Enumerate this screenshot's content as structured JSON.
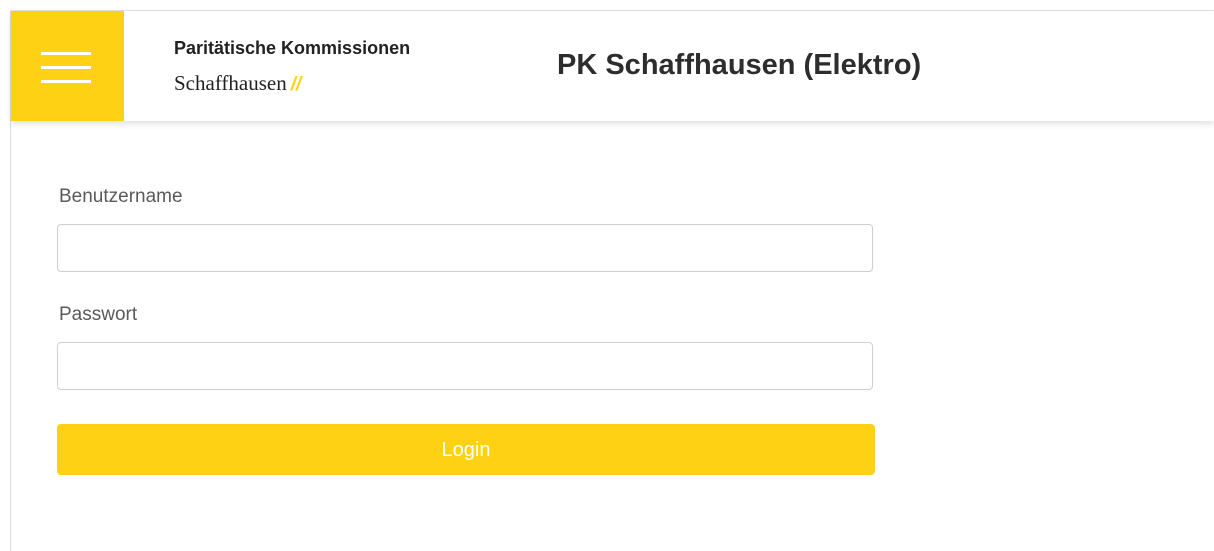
{
  "header": {
    "menu_icon": "hamburger-menu-icon",
    "logo": {
      "line1": "Paritätische Kommissionen",
      "line2": "Schaffhausen",
      "slashes": "//"
    },
    "title": "PK Schaffhausen (Elektro)"
  },
  "login_form": {
    "username": {
      "label": "Benutzername",
      "value": "",
      "placeholder": ""
    },
    "password": {
      "label": "Passwort",
      "value": "",
      "placeholder": ""
    },
    "submit_label": "Login"
  },
  "colors": {
    "brand_yellow": "#ffd115",
    "title_text": "#2d2d2d",
    "label_text": "#5a5a5a",
    "input_border": "#cfcfcf"
  }
}
